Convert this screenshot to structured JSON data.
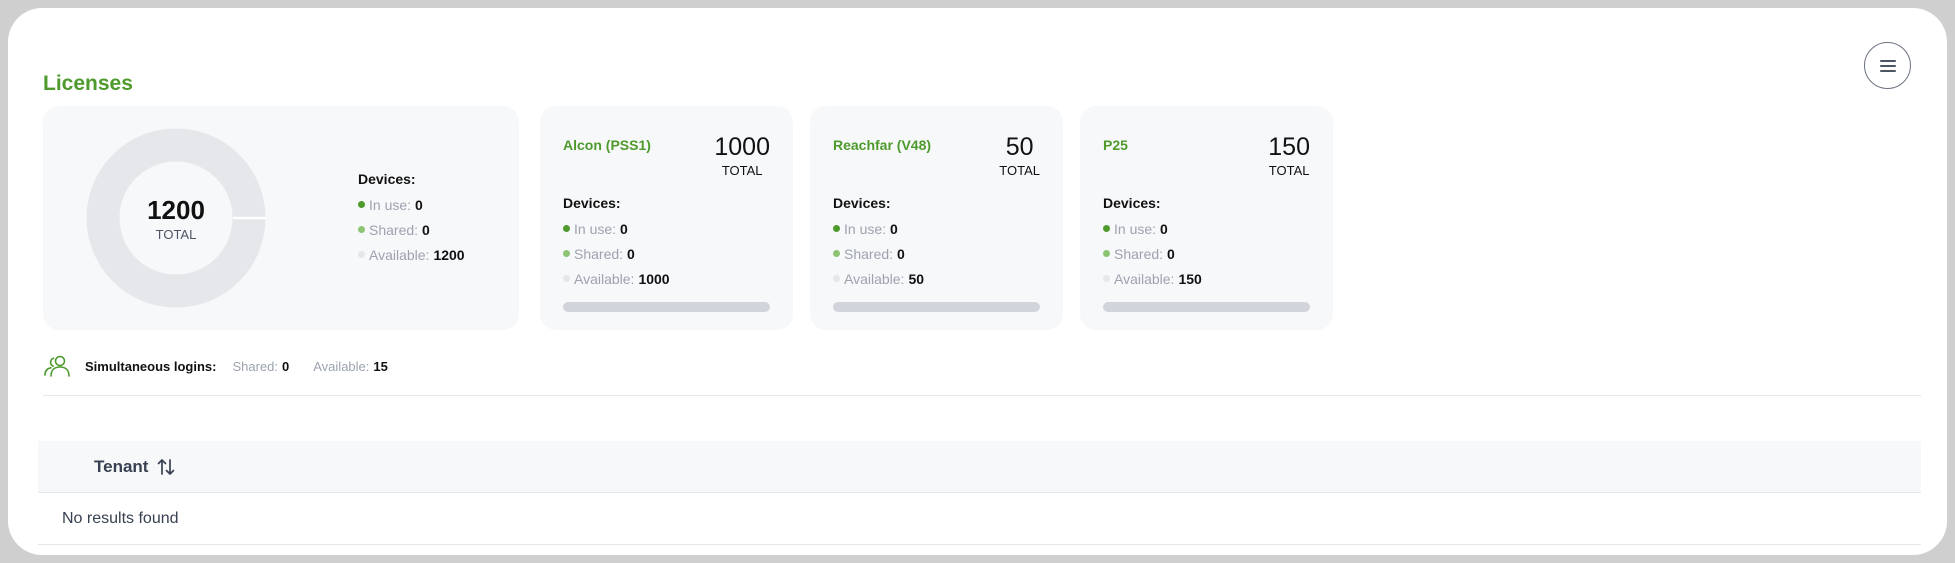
{
  "header": {
    "title": "Licenses",
    "menu_icon": "hamburger-menu-icon"
  },
  "summary": {
    "total_value": "1200",
    "total_label": "TOTAL",
    "devices_label": "Devices:",
    "in_use_label": "In use:",
    "in_use_value": "0",
    "shared_label": "Shared:",
    "shared_value": "0",
    "available_label": "Available:",
    "available_value": "1200"
  },
  "license_cards": [
    {
      "name": "Alcon (PSS1)",
      "total_value": "1000",
      "total_label": "TOTAL",
      "devices_label": "Devices:",
      "in_use_label": "In use:",
      "in_use_value": "0",
      "shared_label": "Shared:",
      "shared_value": "0",
      "available_label": "Available:",
      "available_value": "1000",
      "usage_fraction": 0
    },
    {
      "name": "Reachfar (V48)",
      "total_value": "50",
      "total_label": "TOTAL",
      "devices_label": "Devices:",
      "in_use_label": "In use:",
      "in_use_value": "0",
      "shared_label": "Shared:",
      "shared_value": "0",
      "available_label": "Available:",
      "available_value": "50",
      "usage_fraction": 0
    },
    {
      "name": "P25",
      "total_value": "150",
      "total_label": "TOTAL",
      "devices_label": "Devices:",
      "in_use_label": "In use:",
      "in_use_value": "0",
      "shared_label": "Shared:",
      "shared_value": "0",
      "available_label": "Available:",
      "available_value": "150",
      "usage_fraction": 0
    }
  ],
  "simultaneous": {
    "icon": "users-icon",
    "label": "Simultaneous logins:",
    "shared_label": "Shared:",
    "shared_value": "0",
    "available_label": "Available:",
    "available_value": "15"
  },
  "table": {
    "columns": [
      {
        "label": "Tenant",
        "sort_icon": "sort-arrows-icon"
      }
    ],
    "empty_text": "No results found"
  },
  "colors": {
    "accent": "#4e9a2c",
    "shared": "#8cc474",
    "available": "#e5e7eb",
    "bar_track": "#d1d5db"
  }
}
